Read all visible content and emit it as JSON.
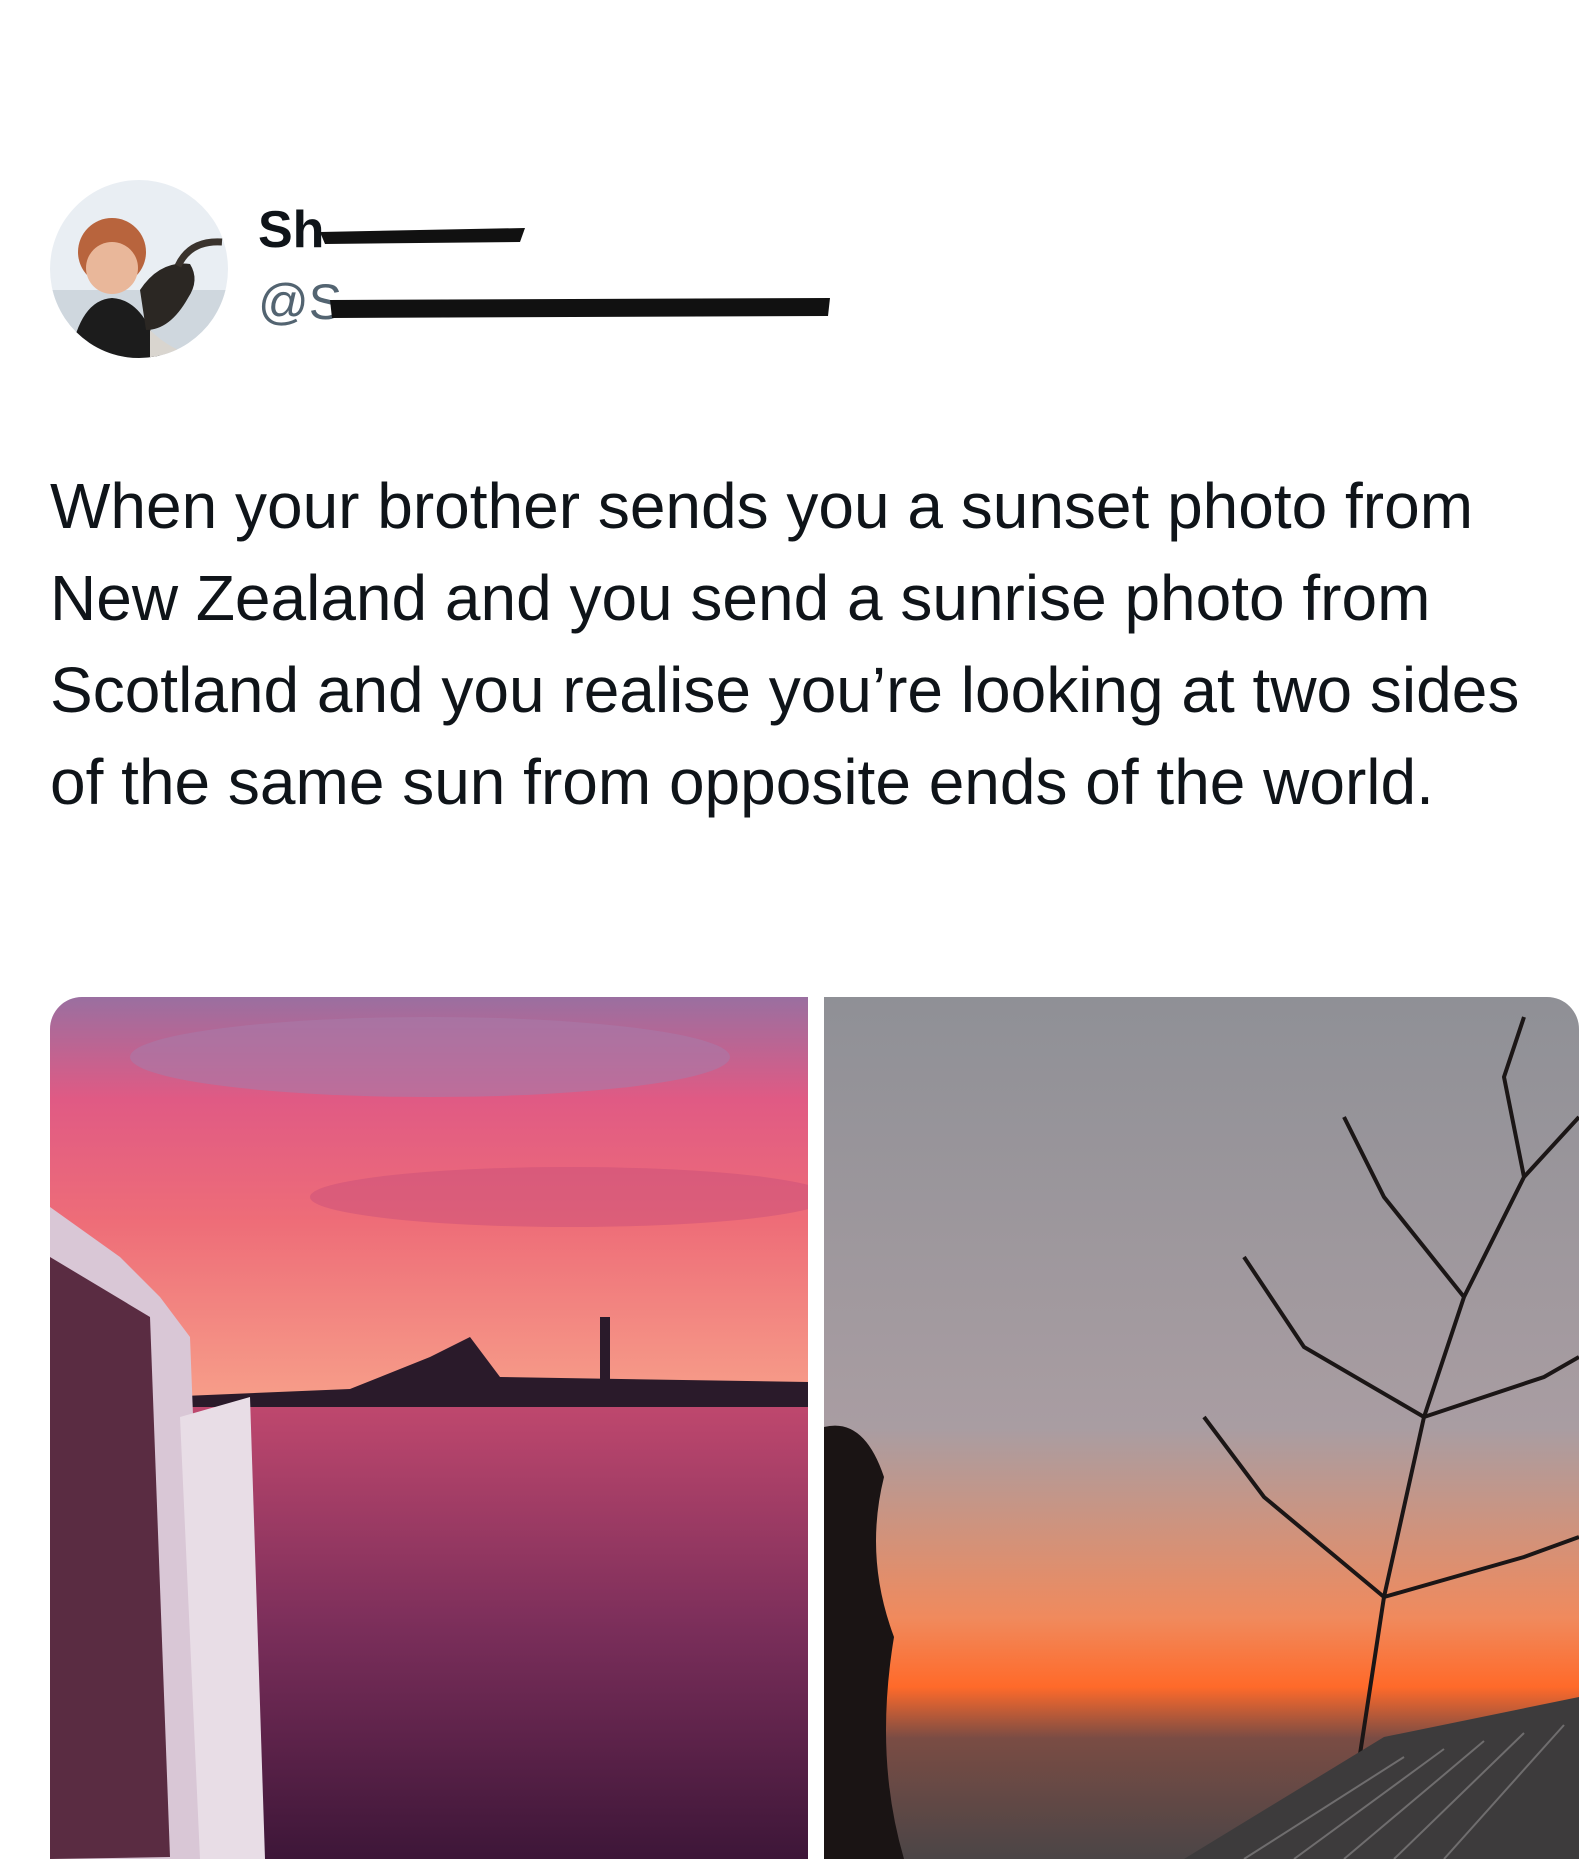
{
  "tweet": {
    "author": {
      "display_name": "Sh",
      "handle": "@S",
      "avatar": "avatar-photo-person-with-goat"
    },
    "text": "When your brother sends you a sunset photo from New Zealand and you send a sunrise photo from Scotland and you realise you’re looking at two sides of the same sun from opposite ends of the world.",
    "media": [
      {
        "subject": "pink-purple-sunset-harbour-boat"
      },
      {
        "subject": "orange-sunrise-bare-tree-roof"
      }
    ]
  },
  "colors": {
    "text": "#0f1419",
    "secondary_text": "#536471",
    "background": "#ffffff"
  }
}
